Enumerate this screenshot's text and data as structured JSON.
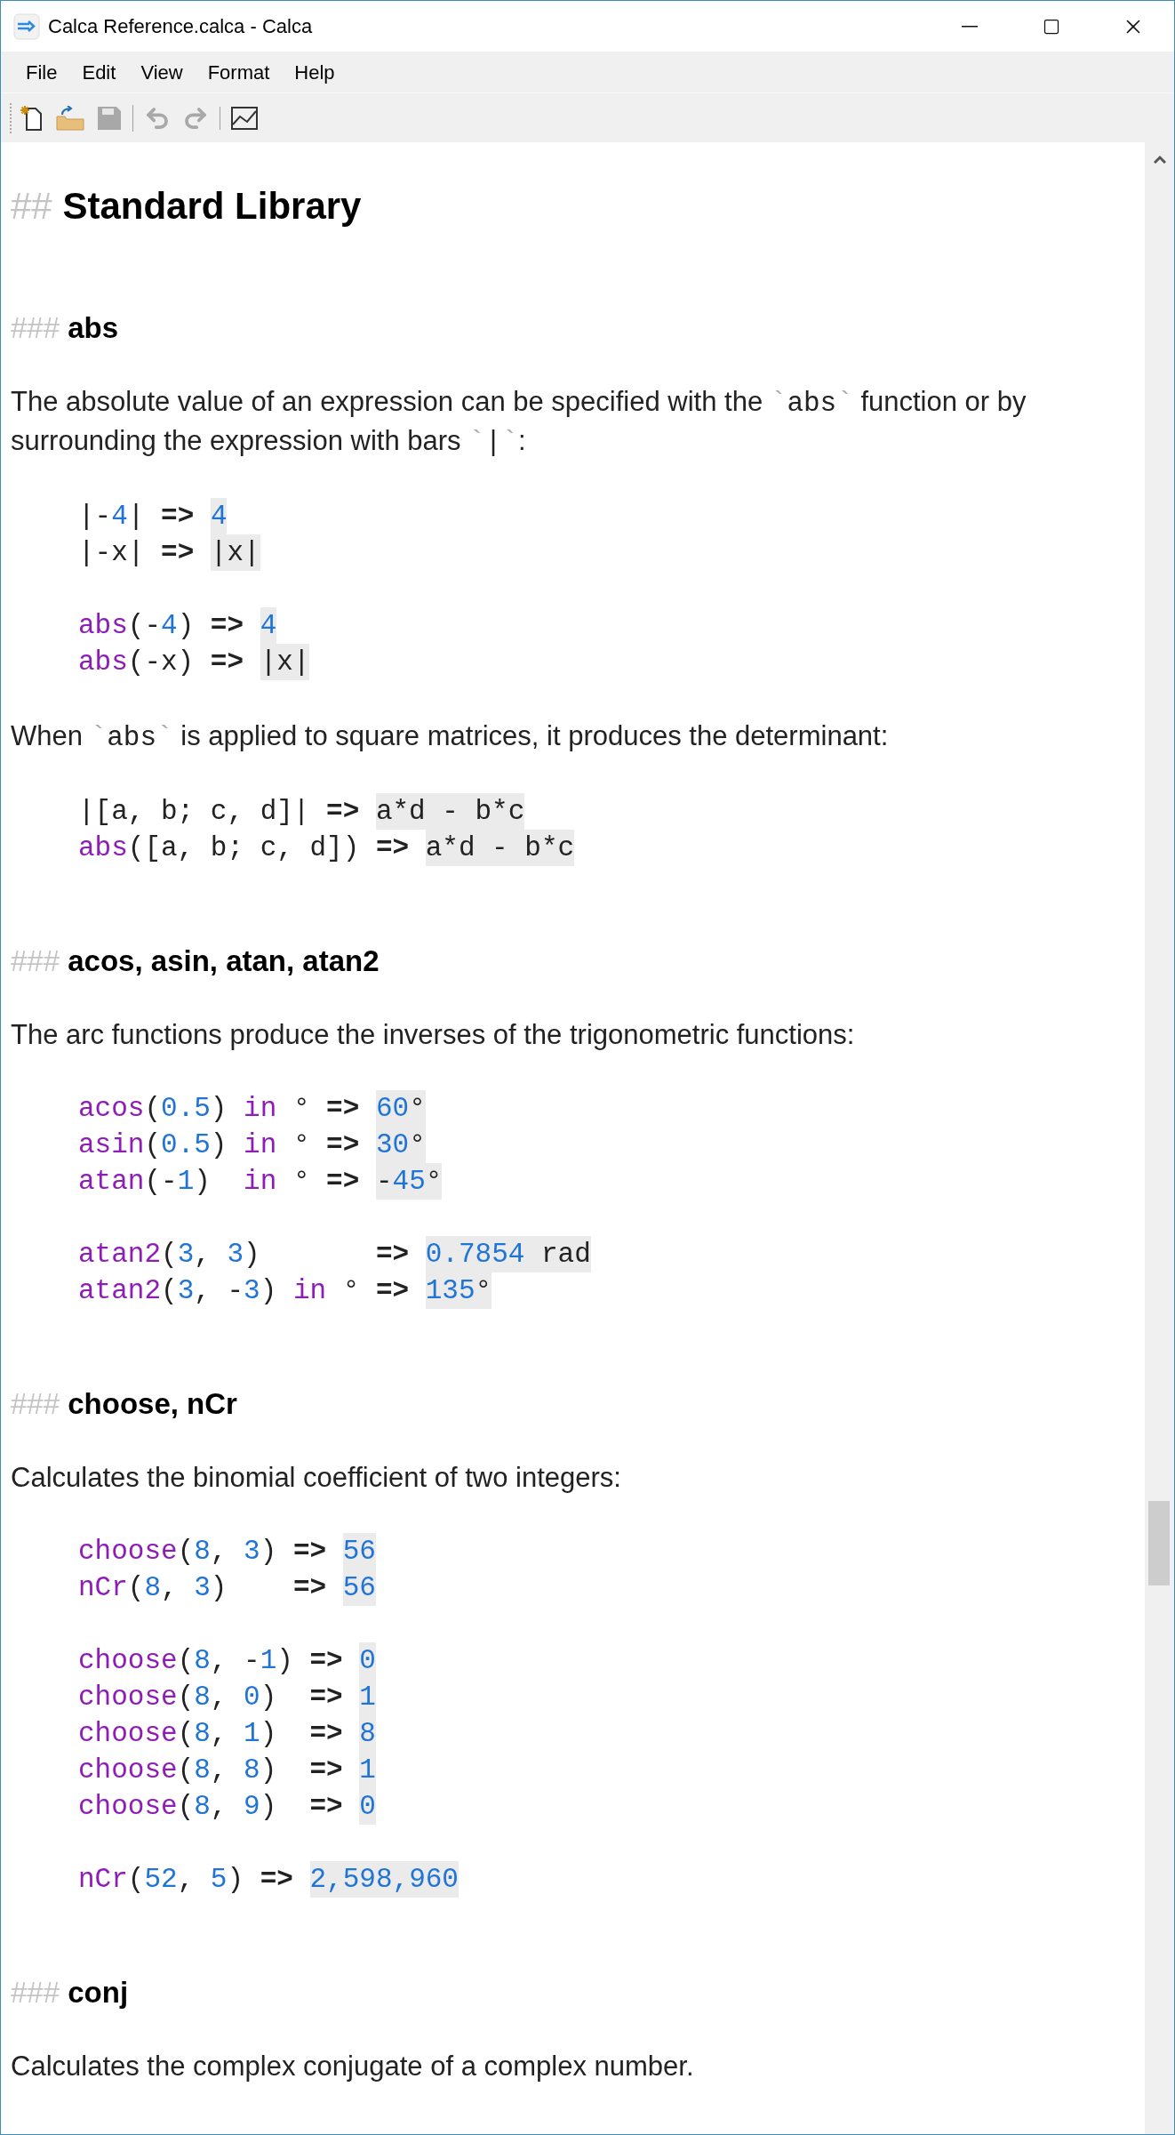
{
  "window": {
    "title": "Calca Reference.calca - Calca"
  },
  "menu": [
    {
      "label": "File"
    },
    {
      "label": "Edit"
    },
    {
      "label": "View"
    },
    {
      "label": "Format"
    },
    {
      "label": "Help"
    }
  ],
  "toolbar": [
    {
      "items": [
        {
          "kind": "new",
          "disabled": false
        },
        {
          "kind": "open",
          "disabled": false
        },
        {
          "kind": "save",
          "disabled": true
        }
      ]
    },
    {
      "items": [
        {
          "kind": "undo",
          "disabled": true
        },
        {
          "kind": "redo",
          "disabled": true
        }
      ]
    },
    {
      "items": [
        {
          "kind": "chart",
          "disabled": false
        }
      ]
    }
  ],
  "document": [
    {
      "kind": "h2",
      "marker": "##",
      "text": "Standard Library"
    },
    {
      "kind": "h3",
      "marker": "###",
      "text": "abs"
    },
    {
      "kind": "para",
      "parts": [
        {
          "kind": "text",
          "text": "The absolute value of an expression can be specified with the "
        },
        {
          "kind": "tick",
          "text": "`"
        },
        {
          "kind": "code",
          "text": "abs"
        },
        {
          "kind": "tick",
          "text": "`"
        },
        {
          "kind": "text",
          "text": " function or by surrounding the expression with bars "
        },
        {
          "kind": "tick",
          "text": "`"
        },
        {
          "kind": "code",
          "text": "|"
        },
        {
          "kind": "tick",
          "text": "`"
        },
        {
          "kind": "text",
          "text": ":"
        }
      ]
    },
    {
      "kind": "code",
      "lines": [
        {
          "expr": [
            {
              "kind": "plain",
              "text": "|-"
            },
            {
              "kind": "num",
              "text": "4"
            },
            {
              "kind": "plain",
              "text": "|"
            }
          ],
          "arrow": "=>",
          "result": [
            {
              "kind": "num",
              "text": "4"
            }
          ]
        },
        {
          "expr": [
            {
              "kind": "plain",
              "text": "|-x|"
            }
          ],
          "arrow": "=>",
          "result": [
            {
              "kind": "plain",
              "text": "|x|"
            }
          ]
        }
      ]
    },
    {
      "kind": "code",
      "lines": [
        {
          "expr": [
            {
              "kind": "fn",
              "text": "abs"
            },
            {
              "kind": "plain",
              "text": "(-"
            },
            {
              "kind": "num",
              "text": "4"
            },
            {
              "kind": "plain",
              "text": ")"
            }
          ],
          "arrow": "=>",
          "result": [
            {
              "kind": "num",
              "text": "4"
            }
          ]
        },
        {
          "expr": [
            {
              "kind": "fn",
              "text": "abs"
            },
            {
              "kind": "plain",
              "text": "(-x)"
            }
          ],
          "arrow": "=>",
          "result": [
            {
              "kind": "plain",
              "text": "|x|"
            }
          ]
        }
      ]
    },
    {
      "kind": "para",
      "parts": [
        {
          "kind": "text",
          "text": "When "
        },
        {
          "kind": "tick",
          "text": "`"
        },
        {
          "kind": "code",
          "text": "abs"
        },
        {
          "kind": "tick",
          "text": "`"
        },
        {
          "kind": "text",
          "text": " is applied to square matrices, it produces the determinant:"
        }
      ]
    },
    {
      "kind": "code",
      "lines": [
        {
          "expr": [
            {
              "kind": "plain",
              "text": "|[a, b; c, d]|"
            }
          ],
          "arrow": "=>",
          "result": [
            {
              "kind": "plain",
              "text": "a*d - b*c"
            }
          ]
        },
        {
          "expr": [
            {
              "kind": "fn",
              "text": "abs"
            },
            {
              "kind": "plain",
              "text": "([a, b; c, d])"
            }
          ],
          "arrow": "=>",
          "result": [
            {
              "kind": "plain",
              "text": "a*d - b*c"
            }
          ]
        }
      ]
    },
    {
      "kind": "h3",
      "marker": "###",
      "text": "acos, asin, atan, atan2"
    },
    {
      "kind": "para",
      "parts": [
        {
          "kind": "text",
          "text": "The arc functions produce the inverses of the trigonometric functions:"
        }
      ]
    },
    {
      "kind": "code",
      "lines": [
        {
          "expr": [
            {
              "kind": "fn",
              "text": "acos"
            },
            {
              "kind": "plain",
              "text": "("
            },
            {
              "kind": "num",
              "text": "0.5"
            },
            {
              "kind": "plain",
              "text": ") "
            },
            {
              "kind": "fn",
              "text": "in"
            },
            {
              "kind": "plain",
              "text": " °"
            }
          ],
          "arrow": "=>",
          "result": [
            {
              "kind": "num",
              "text": "60"
            },
            {
              "kind": "plain",
              "text": "°"
            }
          ]
        },
        {
          "expr": [
            {
              "kind": "fn",
              "text": "asin"
            },
            {
              "kind": "plain",
              "text": "("
            },
            {
              "kind": "num",
              "text": "0.5"
            },
            {
              "kind": "plain",
              "text": ") "
            },
            {
              "kind": "fn",
              "text": "in"
            },
            {
              "kind": "plain",
              "text": " °"
            }
          ],
          "arrow": "=>",
          "result": [
            {
              "kind": "num",
              "text": "30"
            },
            {
              "kind": "plain",
              "text": "°"
            }
          ]
        },
        {
          "expr": [
            {
              "kind": "fn",
              "text": "atan"
            },
            {
              "kind": "plain",
              "text": "(-"
            },
            {
              "kind": "num",
              "text": "1"
            },
            {
              "kind": "plain",
              "text": ")  "
            },
            {
              "kind": "fn",
              "text": "in"
            },
            {
              "kind": "plain",
              "text": " °"
            }
          ],
          "arrow": "=>",
          "result": [
            {
              "kind": "plain",
              "text": "-"
            },
            {
              "kind": "num",
              "text": "45"
            },
            {
              "kind": "plain",
              "text": "°"
            }
          ]
        }
      ]
    },
    {
      "kind": "code",
      "lines": [
        {
          "expr": [
            {
              "kind": "fn",
              "text": "atan2"
            },
            {
              "kind": "plain",
              "text": "("
            },
            {
              "kind": "num",
              "text": "3"
            },
            {
              "kind": "plain",
              "text": ", "
            },
            {
              "kind": "num",
              "text": "3"
            },
            {
              "kind": "plain",
              "text": ")      "
            }
          ],
          "arrow": "=>",
          "result": [
            {
              "kind": "num",
              "text": "0.7854"
            },
            {
              "kind": "plain",
              "text": " rad"
            }
          ]
        },
        {
          "expr": [
            {
              "kind": "fn",
              "text": "atan2"
            },
            {
              "kind": "plain",
              "text": "("
            },
            {
              "kind": "num",
              "text": "3"
            },
            {
              "kind": "plain",
              "text": ", -"
            },
            {
              "kind": "num",
              "text": "3"
            },
            {
              "kind": "plain",
              "text": ") "
            },
            {
              "kind": "fn",
              "text": "in"
            },
            {
              "kind": "plain",
              "text": " °"
            }
          ],
          "arrow": "=>",
          "result": [
            {
              "kind": "num",
              "text": "135"
            },
            {
              "kind": "plain",
              "text": "°"
            }
          ]
        }
      ]
    },
    {
      "kind": "h3",
      "marker": "###",
      "text": "choose, nCr"
    },
    {
      "kind": "para",
      "parts": [
        {
          "kind": "text",
          "text": "Calculates the binomial coefficient of two integers:"
        }
      ]
    },
    {
      "kind": "code",
      "lines": [
        {
          "expr": [
            {
              "kind": "fn",
              "text": "choose"
            },
            {
              "kind": "plain",
              "text": "("
            },
            {
              "kind": "num",
              "text": "8"
            },
            {
              "kind": "plain",
              "text": ", "
            },
            {
              "kind": "num",
              "text": "3"
            },
            {
              "kind": "plain",
              "text": ")"
            }
          ],
          "arrow": "=>",
          "result": [
            {
              "kind": "num",
              "text": "56"
            }
          ]
        },
        {
          "expr": [
            {
              "kind": "fn",
              "text": "nCr"
            },
            {
              "kind": "plain",
              "text": "("
            },
            {
              "kind": "num",
              "text": "8"
            },
            {
              "kind": "plain",
              "text": ", "
            },
            {
              "kind": "num",
              "text": "3"
            },
            {
              "kind": "plain",
              "text": ")   "
            }
          ],
          "arrow": "=>",
          "result": [
            {
              "kind": "num",
              "text": "56"
            }
          ]
        }
      ]
    },
    {
      "kind": "code",
      "lines": [
        {
          "expr": [
            {
              "kind": "fn",
              "text": "choose"
            },
            {
              "kind": "plain",
              "text": "("
            },
            {
              "kind": "num",
              "text": "8"
            },
            {
              "kind": "plain",
              "text": ", -"
            },
            {
              "kind": "num",
              "text": "1"
            },
            {
              "kind": "plain",
              "text": ")"
            }
          ],
          "arrow": "=>",
          "result": [
            {
              "kind": "num",
              "text": "0"
            }
          ]
        },
        {
          "expr": [
            {
              "kind": "fn",
              "text": "choose"
            },
            {
              "kind": "plain",
              "text": "("
            },
            {
              "kind": "num",
              "text": "8"
            },
            {
              "kind": "plain",
              "text": ", "
            },
            {
              "kind": "num",
              "text": "0"
            },
            {
              "kind": "plain",
              "text": ") "
            }
          ],
          "arrow": "=>",
          "result": [
            {
              "kind": "num",
              "text": "1"
            }
          ]
        },
        {
          "expr": [
            {
              "kind": "fn",
              "text": "choose"
            },
            {
              "kind": "plain",
              "text": "("
            },
            {
              "kind": "num",
              "text": "8"
            },
            {
              "kind": "plain",
              "text": ", "
            },
            {
              "kind": "num",
              "text": "1"
            },
            {
              "kind": "plain",
              "text": ") "
            }
          ],
          "arrow": "=>",
          "result": [
            {
              "kind": "num",
              "text": "8"
            }
          ]
        },
        {
          "expr": [
            {
              "kind": "fn",
              "text": "choose"
            },
            {
              "kind": "plain",
              "text": "("
            },
            {
              "kind": "num",
              "text": "8"
            },
            {
              "kind": "plain",
              "text": ", "
            },
            {
              "kind": "num",
              "text": "8"
            },
            {
              "kind": "plain",
              "text": ") "
            }
          ],
          "arrow": "=>",
          "result": [
            {
              "kind": "num",
              "text": "1"
            }
          ]
        },
        {
          "expr": [
            {
              "kind": "fn",
              "text": "choose"
            },
            {
              "kind": "plain",
              "text": "("
            },
            {
              "kind": "num",
              "text": "8"
            },
            {
              "kind": "plain",
              "text": ", "
            },
            {
              "kind": "num",
              "text": "9"
            },
            {
              "kind": "plain",
              "text": ") "
            }
          ],
          "arrow": "=>",
          "result": [
            {
              "kind": "num",
              "text": "0"
            }
          ]
        }
      ]
    },
    {
      "kind": "code",
      "lines": [
        {
          "expr": [
            {
              "kind": "fn",
              "text": "nCr"
            },
            {
              "kind": "plain",
              "text": "("
            },
            {
              "kind": "num",
              "text": "52"
            },
            {
              "kind": "plain",
              "text": ", "
            },
            {
              "kind": "num",
              "text": "5"
            },
            {
              "kind": "plain",
              "text": ")"
            }
          ],
          "arrow": "=>",
          "result": [
            {
              "kind": "num",
              "text": "2,598,960"
            }
          ]
        }
      ]
    },
    {
      "kind": "h3",
      "marker": "###",
      "text": "conj"
    },
    {
      "kind": "para",
      "parts": [
        {
          "kind": "text",
          "text": "Calculates the complex conjugate of a complex number."
        }
      ]
    }
  ]
}
